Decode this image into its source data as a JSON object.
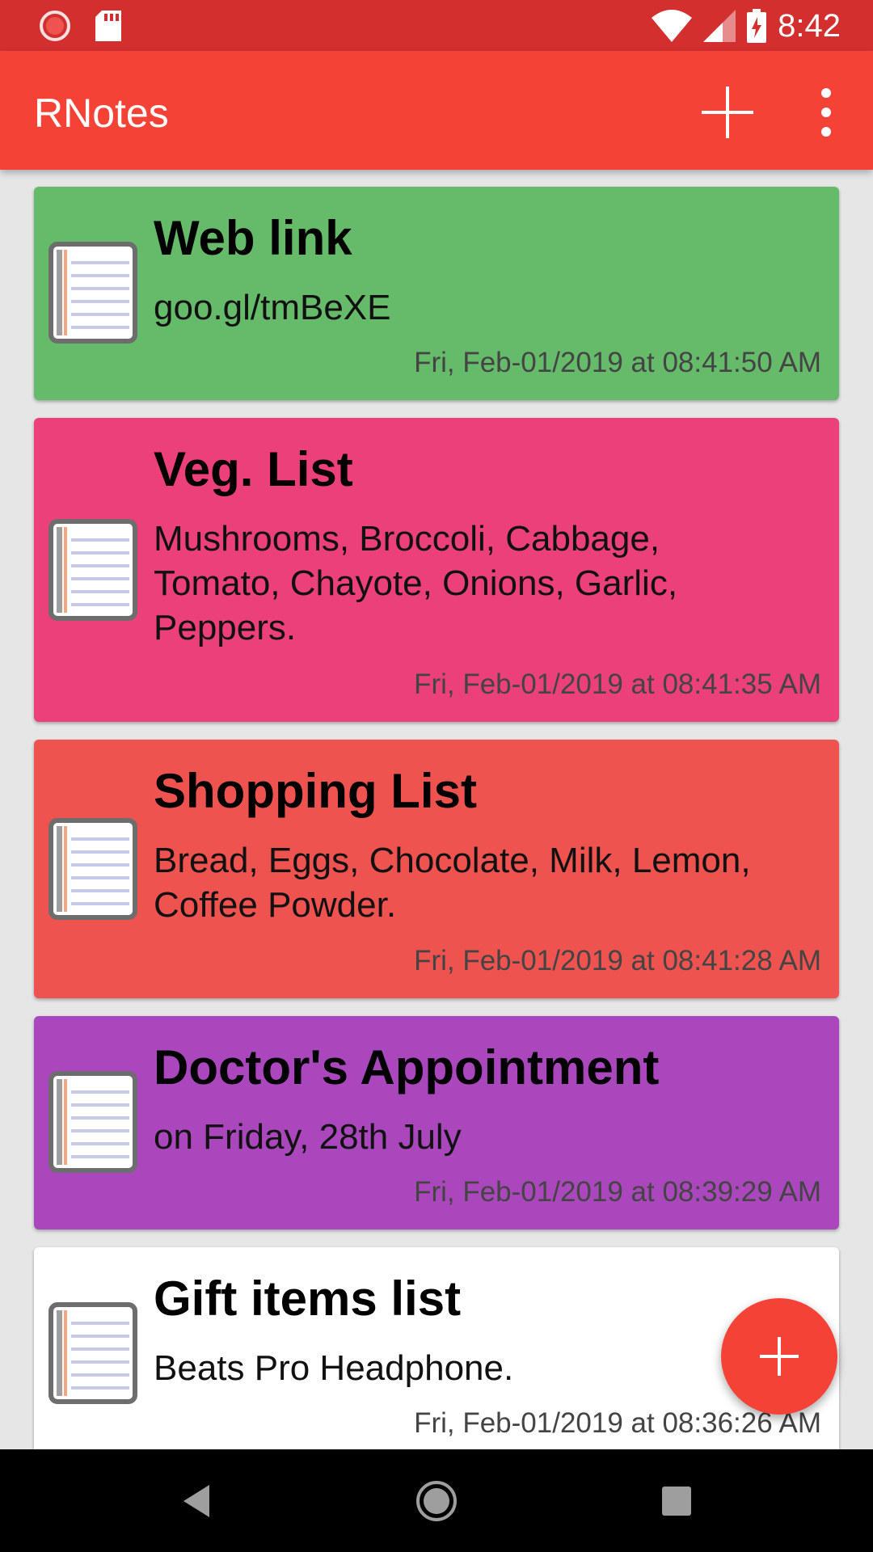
{
  "status_bar": {
    "time": "8:42",
    "icons_left": [
      "loading-icon",
      "sd-card-icon"
    ],
    "icons_right": [
      "wifi-icon",
      "signal-icon",
      "battery-charging-icon"
    ]
  },
  "app_bar": {
    "title": "RNotes",
    "actions": [
      "add-icon",
      "overflow-menu-icon"
    ]
  },
  "notes": [
    {
      "title": "Web link",
      "body": "goo.gl/tmBeXE",
      "date": "Fri, Feb-01/2019 at 08:41:50 AM",
      "color": "#66bb6a"
    },
    {
      "title": "Veg. List",
      "body": [
        "Mushrooms, Broccoli, Cabbage,",
        "Tomato, Chayote, Onions, Garlic,",
        "Peppers."
      ],
      "date": "Fri, Feb-01/2019 at 08:41:35 AM",
      "color": "#ec407a"
    },
    {
      "title": "Shopping List",
      "body": [
        "Bread, Eggs, Chocolate, Milk, Lemon,",
        "Coffee Powder."
      ],
      "date": "Fri, Feb-01/2019 at 08:41:28 AM",
      "color": "#ef5350"
    },
    {
      "title": "Doctor's Appointment",
      "body": "on Friday, 28th July",
      "date": "Fri, Feb-01/2019 at 08:39:29 AM",
      "color": "#ab47bc"
    },
    {
      "title": "Gift items list",
      "body": "Beats Pro Headphone.",
      "date": "Fri, Feb-01/2019 at 08:36:26 AM",
      "color": "#ffffff"
    }
  ],
  "fab": {
    "icon": "add-icon",
    "color": "#f44336"
  },
  "nav_bar": {
    "buttons": [
      "back-icon",
      "home-icon",
      "recents-icon"
    ]
  }
}
